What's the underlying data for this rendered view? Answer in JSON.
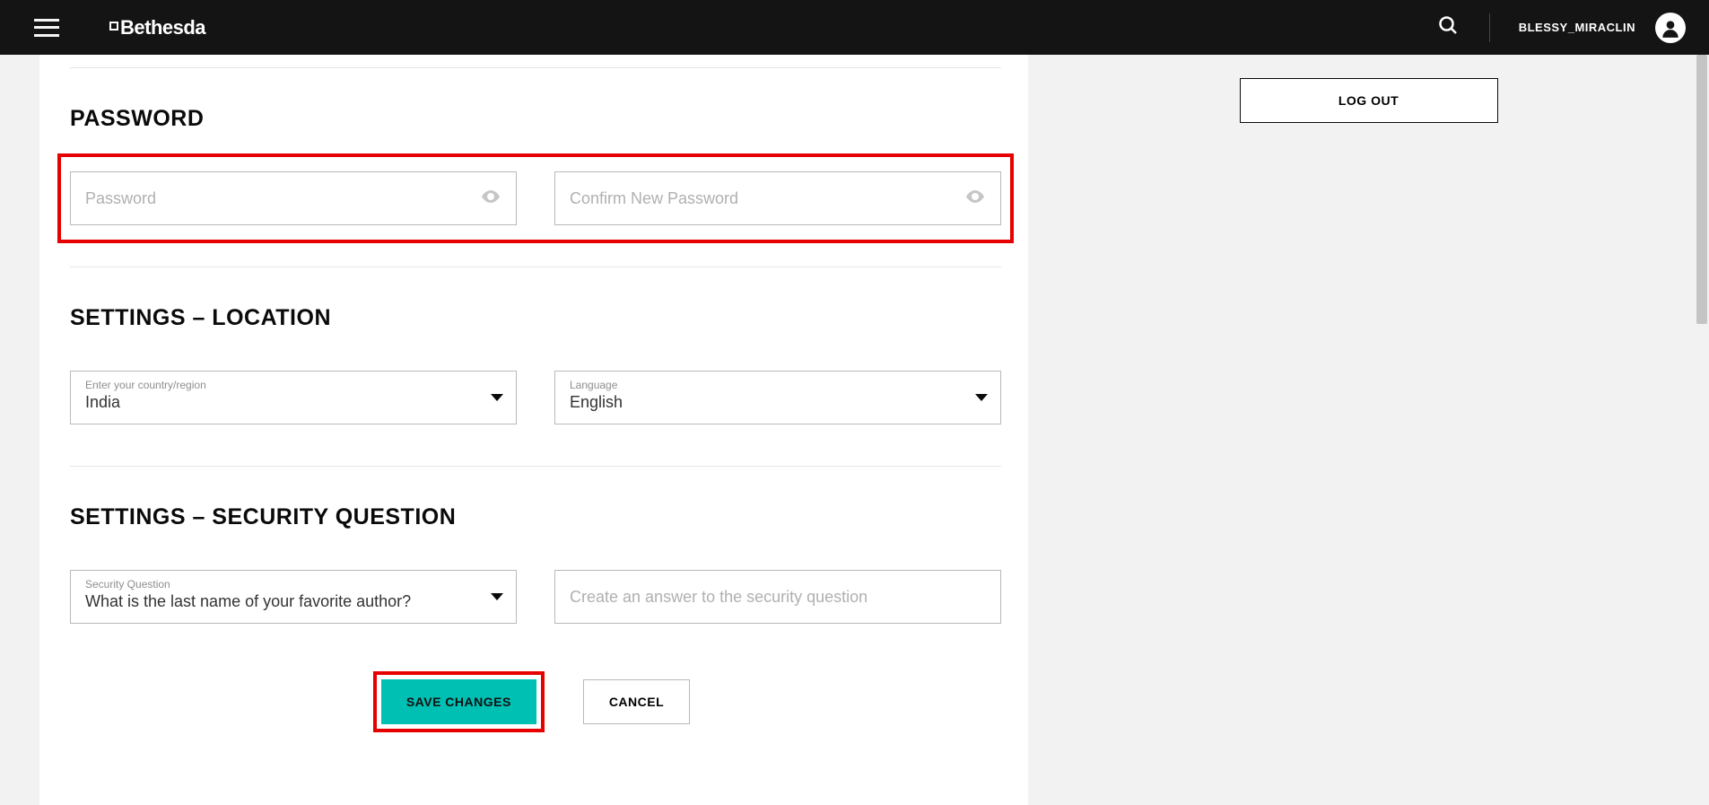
{
  "header": {
    "brand": "Bethesda",
    "username": "BLESSY_MIRACLIN"
  },
  "sections": {
    "password_title": "PASSWORD",
    "location_title": "SETTINGS – LOCATION",
    "security_title": "SETTINGS – SECURITY QUESTION"
  },
  "password": {
    "placeholder": "Password",
    "confirm_placeholder": "Confirm New Password"
  },
  "location": {
    "country_label": "Enter your country/region",
    "country_value": "India",
    "language_label": "Language",
    "language_value": "English"
  },
  "security": {
    "question_label": "Security Question",
    "question_value": "What is the last name of your favorite author?",
    "answer_placeholder": "Create an answer to the security question"
  },
  "buttons": {
    "save": "SAVE CHANGES",
    "cancel": "CANCEL",
    "logout": "LOG OUT"
  }
}
